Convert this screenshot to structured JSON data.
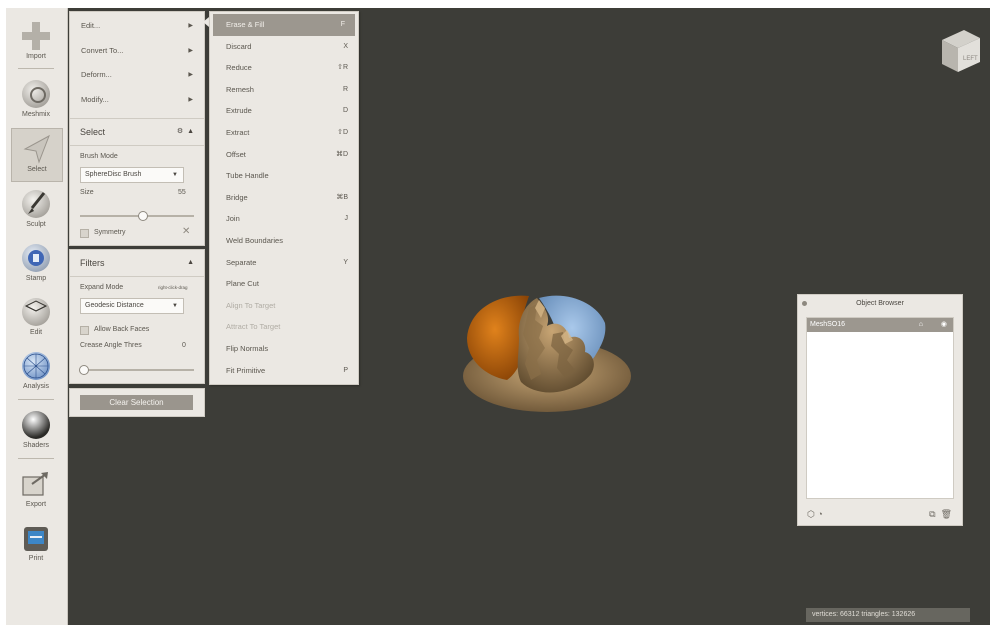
{
  "toolbar": {
    "tools": [
      {
        "label": "Import",
        "icon": "plus-icon"
      },
      {
        "label": "Meshmix",
        "icon": "meshmix-icon"
      },
      {
        "label": "Select",
        "icon": "select-arrow-icon"
      },
      {
        "label": "Sculpt",
        "icon": "brush-icon"
      },
      {
        "label": "Stamp",
        "icon": "stamp-icon"
      },
      {
        "label": "Edit",
        "icon": "edit-sphere-icon"
      },
      {
        "label": "Analysis",
        "icon": "analysis-sphere-icon"
      },
      {
        "label": "Shaders",
        "icon": "shader-sphere-icon"
      },
      {
        "label": "Export",
        "icon": "export-icon"
      },
      {
        "label": "Print",
        "icon": "printer-icon"
      }
    ]
  },
  "edit_menu": {
    "items": [
      "Edit...",
      "Convert To...",
      "Deform...",
      "Modify..."
    ]
  },
  "select_panel": {
    "title": "Select",
    "brush_mode_label": "Brush Mode",
    "brush_mode_value": "SphereDisc Brush",
    "size_label": "Size",
    "size_value": "55",
    "size_fraction": 0.55,
    "symmetry_label": "Symmetry"
  },
  "filters_panel": {
    "title": "Filters",
    "expand_mode_label": "Expand Mode",
    "expand_mode_hint": "right-click-drag",
    "expand_mode_value": "Geodesic Distance",
    "allow_back_faces_label": "Allow Back Faces",
    "crease_label": "Crease Angle Thres",
    "crease_value": "0",
    "crease_fraction": 0.0
  },
  "clear_selection_label": "Clear Selection",
  "edit_submenu": {
    "items": [
      {
        "label": "Erase & Fill",
        "shortcut": "F",
        "state": "highlighted"
      },
      {
        "label": "Discard",
        "shortcut": "X",
        "state": "normal"
      },
      {
        "label": "Reduce",
        "shortcut": "⇧R",
        "state": "normal"
      },
      {
        "label": "Remesh",
        "shortcut": "R",
        "state": "normal"
      },
      {
        "label": "Extrude",
        "shortcut": "D",
        "state": "normal"
      },
      {
        "label": "Extract",
        "shortcut": "⇧D",
        "state": "normal"
      },
      {
        "label": "Offset",
        "shortcut": "⌘D",
        "state": "normal"
      },
      {
        "label": "Tube Handle",
        "shortcut": "",
        "state": "normal"
      },
      {
        "label": "Bridge",
        "shortcut": "⌘B",
        "state": "normal"
      },
      {
        "label": "Join",
        "shortcut": "J",
        "state": "normal"
      },
      {
        "label": "Weld Boundaries",
        "shortcut": "",
        "state": "normal"
      },
      {
        "label": "Separate",
        "shortcut": "Y",
        "state": "normal"
      },
      {
        "label": "Plane Cut",
        "shortcut": "",
        "state": "normal"
      },
      {
        "label": "Align To Target",
        "shortcut": "",
        "state": "disabled"
      },
      {
        "label": "Attract To Target",
        "shortcut": "",
        "state": "disabled"
      },
      {
        "label": "Flip Normals",
        "shortcut": "",
        "state": "normal"
      },
      {
        "label": "Fit Primitive",
        "shortcut": "P",
        "state": "normal"
      }
    ]
  },
  "viewcube": {
    "face_label": "LEFT"
  },
  "object_browser": {
    "title": "Object Browser",
    "objects": [
      {
        "name": "MeshSO16",
        "selected": true
      }
    ]
  },
  "status_bar": {
    "text": "vertices: 66312 triangles: 132626"
  },
  "colors": {
    "viewport_bg": "#3d3d38",
    "panel_bg": "#ebe8e3",
    "highlight": "#9c978f",
    "selection_orange": "#c96a10",
    "mesh_tan": "#a98a5f",
    "selection_blue": "#86aedb"
  }
}
